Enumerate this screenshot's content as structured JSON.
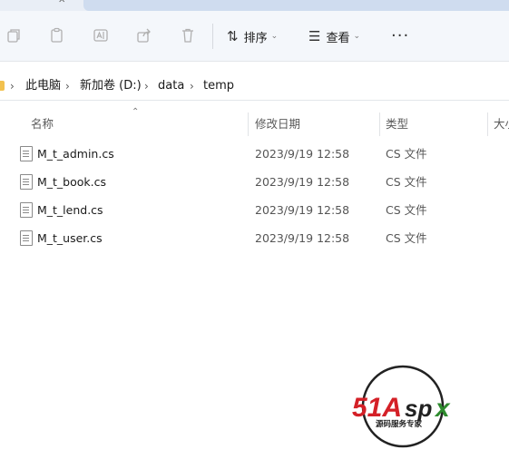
{
  "toolbar": {
    "sort_label": "排序",
    "view_label": "查看",
    "more_label": "···"
  },
  "breadcrumb": [
    "此电脑",
    "新加卷 (D:)",
    "data",
    "temp"
  ],
  "columns": {
    "name": "名称",
    "modified": "修改日期",
    "type": "类型",
    "size": "大小"
  },
  "files": [
    {
      "name": "M_t_admin.cs",
      "modified": "2023/9/19 12:58",
      "type": "CS 文件"
    },
    {
      "name": "M_t_book.cs",
      "modified": "2023/9/19 12:58",
      "type": "CS 文件"
    },
    {
      "name": "M_t_lend.cs",
      "modified": "2023/9/19 12:58",
      "type": "CS 文件"
    },
    {
      "name": "M_t_user.cs",
      "modified": "2023/9/19 12:58",
      "type": "CS 文件"
    }
  ],
  "watermark": {
    "brand": "51Aspx",
    "tagline": "源码服务专家",
    "colors": {
      "red": "#d42027",
      "green": "#2e8b2e",
      "ring": "#222222"
    }
  }
}
